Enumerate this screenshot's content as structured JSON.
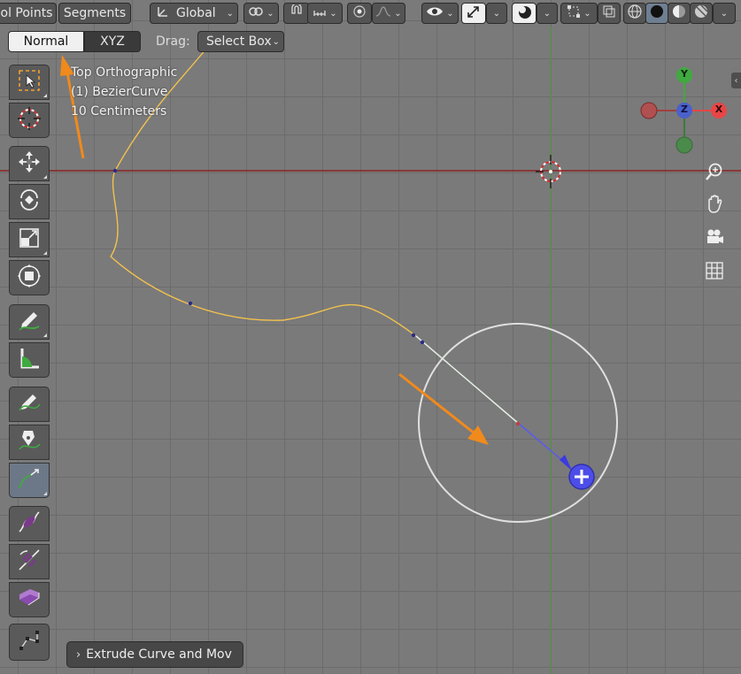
{
  "header": {
    "select_mode_tabs": [
      "ol Points",
      "Segments"
    ],
    "orientation": {
      "label": "Global"
    },
    "tilt_mode": {
      "normal_label": "Normal",
      "xyz_label": "XYZ",
      "active": "Normal"
    },
    "drag": {
      "label": "Drag:",
      "value": "Select Box"
    }
  },
  "viewport_info": {
    "view_name": "Top Orthographic",
    "object_name": "(1) BezierCurve",
    "scale": "10 Centimeters"
  },
  "gizmo": {
    "y_label": "Y",
    "z_label": "Z",
    "x_label": "X"
  },
  "toolbar": {
    "tools": [
      {
        "name": "select-box-tool",
        "icon": "select-box-icon"
      },
      {
        "name": "cursor-tool",
        "icon": "cursor-icon"
      },
      {
        "name": "move-tool",
        "icon": "move-icon"
      },
      {
        "name": "rotate-tool",
        "icon": "rotate-icon"
      },
      {
        "name": "scale-tool",
        "icon": "scale-icon"
      },
      {
        "name": "transform-tool",
        "icon": "transform-icon"
      },
      {
        "name": "annotate-tool",
        "icon": "annotate-icon"
      },
      {
        "name": "measure-tool",
        "icon": "measure-icon"
      },
      {
        "name": "draw-tool",
        "icon": "draw-curve-icon"
      },
      {
        "name": "curve-pen-tool",
        "icon": "curve-pen-icon"
      },
      {
        "name": "extrude-tool",
        "icon": "extrude-curve-icon",
        "active": true
      },
      {
        "name": "radius-tool",
        "icon": "radius-icon"
      },
      {
        "name": "tilt-tool",
        "icon": "tilt-icon"
      },
      {
        "name": "randomize-tool",
        "icon": "randomize-icon"
      },
      {
        "name": "vertex-tool",
        "icon": "vertex-icon"
      }
    ]
  },
  "redo_panel": {
    "label": "Extrude Curve and Mov"
  },
  "colors": {
    "viewport_bg": "#7a7a7a",
    "grid": "#6c6c6c",
    "x_axis_line": "#8b2222",
    "curve": "#f2c14e",
    "arrow_annotation": "#f08a1c",
    "gizmo_x": "#e84646",
    "gizmo_y": "#3faa3f",
    "gizmo_z": "#4a61c9",
    "extrude_handle": "#4d4de8"
  }
}
